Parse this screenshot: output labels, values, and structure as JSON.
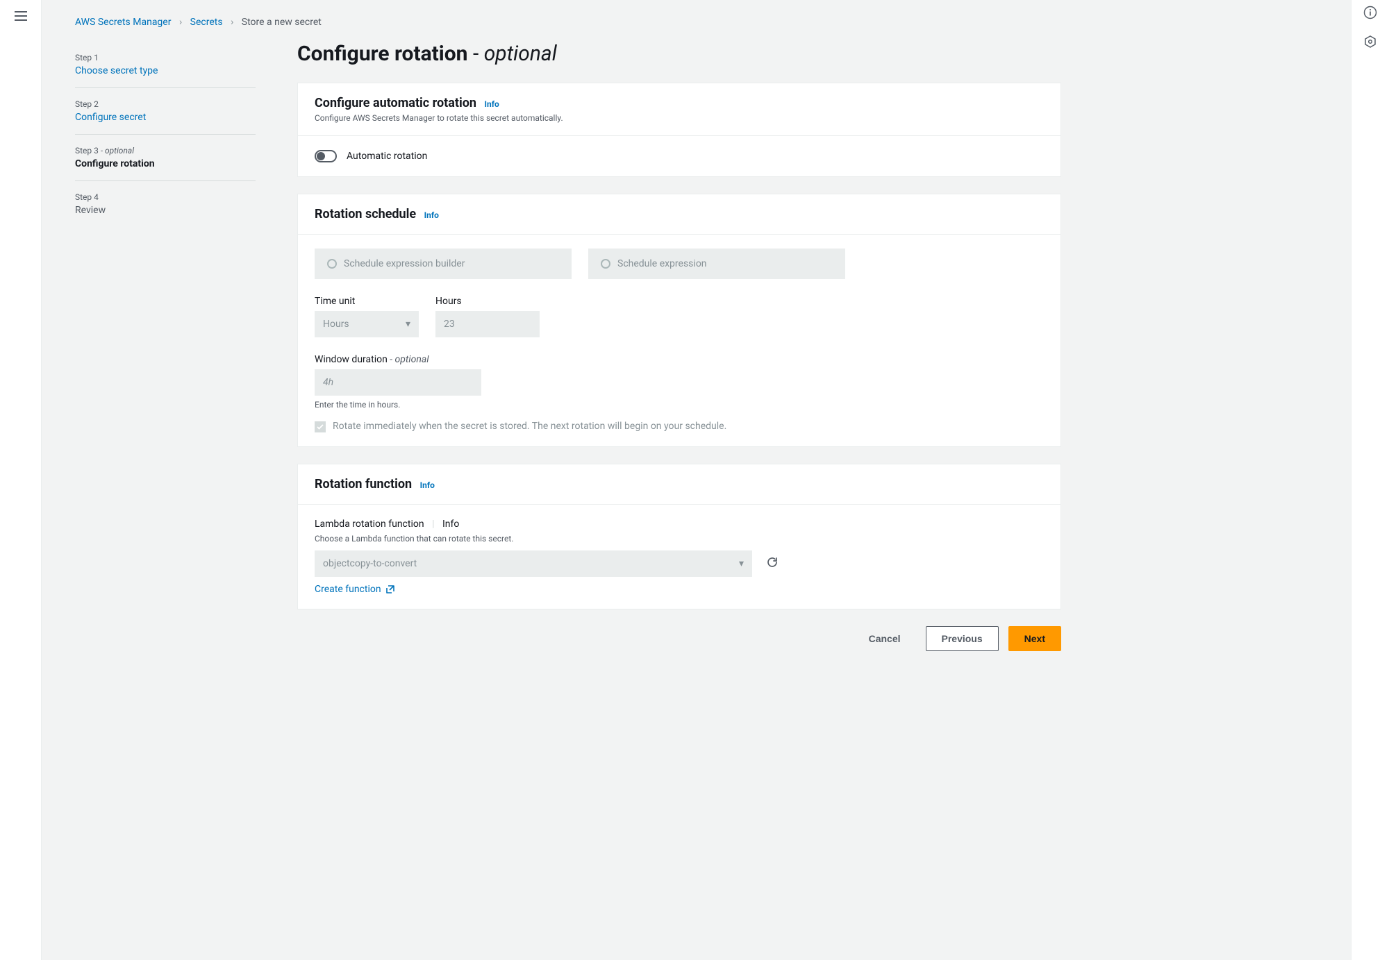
{
  "breadcrumb": {
    "root": "AWS Secrets Manager",
    "section": "Secrets",
    "current": "Store a new secret"
  },
  "steps": [
    {
      "label": "Step 1",
      "optional": "",
      "title": "Choose secret type",
      "state": "link"
    },
    {
      "label": "Step 2",
      "optional": "",
      "title": "Configure secret",
      "state": "link"
    },
    {
      "label": "Step 3",
      "optional": " - optional",
      "title": "Configure rotation",
      "state": "active"
    },
    {
      "label": "Step 4",
      "optional": "",
      "title": "Review",
      "state": "dim"
    }
  ],
  "page_title": {
    "main": "Configure rotation",
    "optional": "optional"
  },
  "sections": {
    "auto_rotation": {
      "title": "Configure automatic rotation",
      "info": "Info",
      "desc": "Configure AWS Secrets Manager to rotate this secret automatically.",
      "toggle_label": "Automatic rotation"
    },
    "schedule": {
      "title": "Rotation schedule",
      "info": "Info",
      "radio1": "Schedule expression builder",
      "radio2": "Schedule expression",
      "time_unit_label": "Time unit",
      "time_unit_value": "Hours",
      "hours_label": "Hours",
      "hours_value": "23",
      "window_label": "Window duration",
      "window_optional": " - optional",
      "window_placeholder": "4h",
      "window_hint": "Enter the time in hours.",
      "rotate_immediately": "Rotate immediately when the secret is stored. The next rotation will begin on your schedule."
    },
    "function": {
      "title": "Rotation function",
      "info": "Info",
      "lambda_label": "Lambda rotation function",
      "lambda_info": "Info",
      "lambda_desc": "Choose a Lambda function that can rotate this secret.",
      "lambda_value": "objectcopy-to-convert",
      "create_fn": "Create function"
    }
  },
  "actions": {
    "cancel": "Cancel",
    "previous": "Previous",
    "next": "Next"
  }
}
